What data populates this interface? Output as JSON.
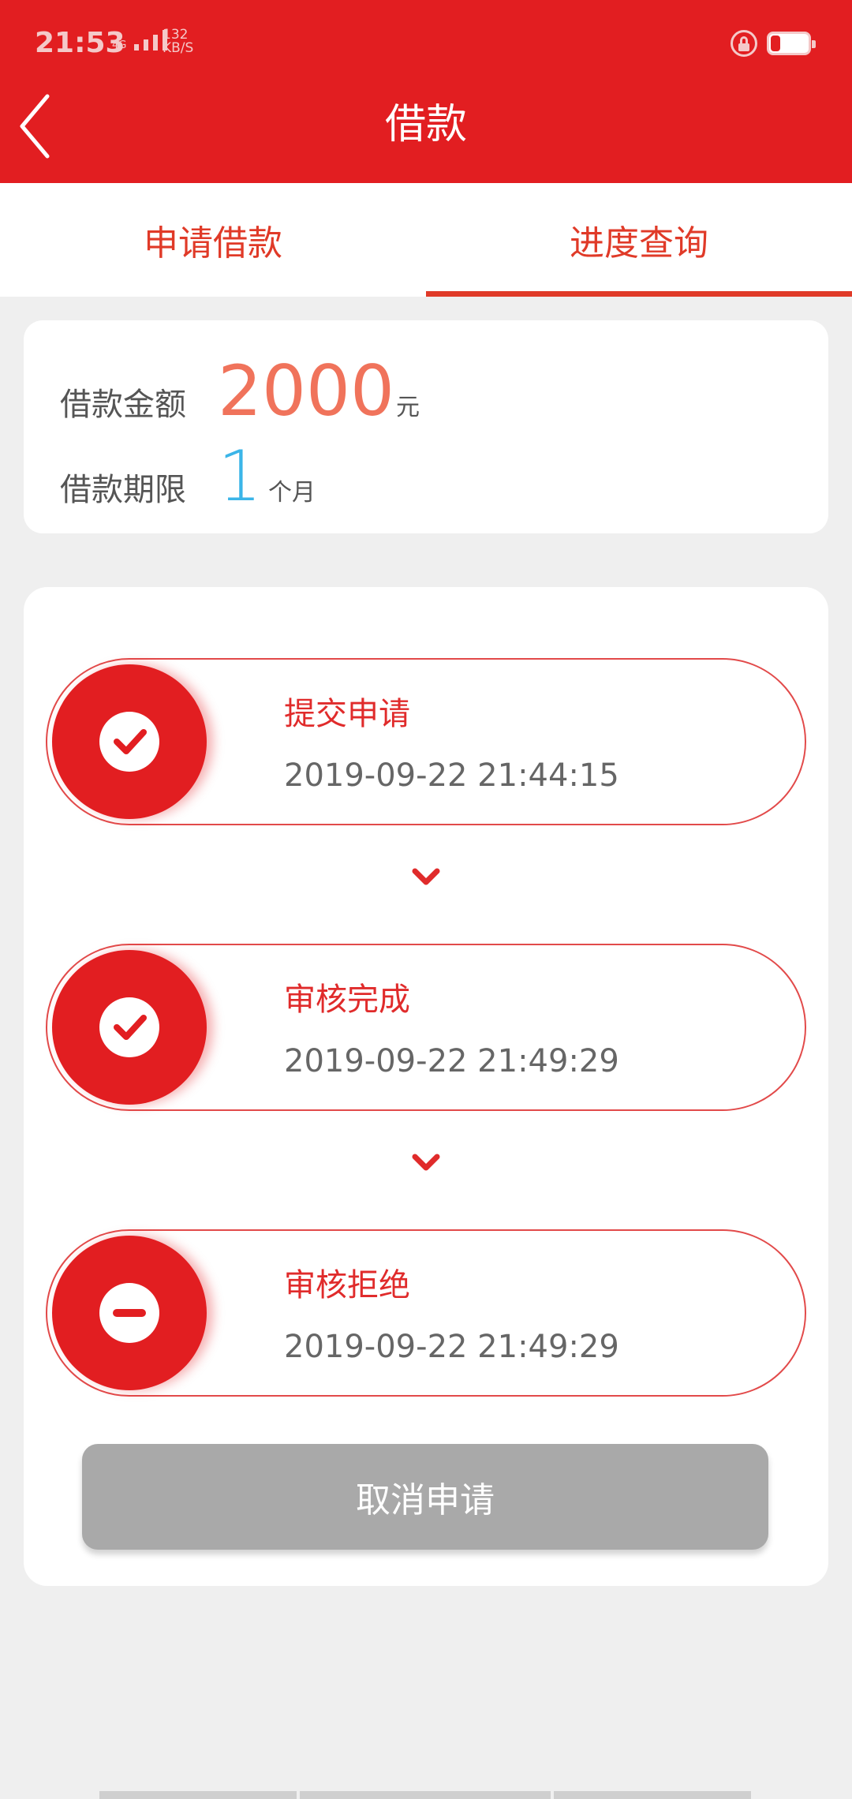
{
  "status_bar": {
    "time": "21:53",
    "network": "4G",
    "speed_value": "132",
    "speed_unit": "KB/S",
    "battery_level": 0.25
  },
  "header": {
    "title": "借款",
    "back_icon": "chevron-left-icon"
  },
  "tabs": [
    {
      "label": "申请借款",
      "active": false
    },
    {
      "label": "进度查询",
      "active": true
    }
  ],
  "loan": {
    "amount_label": "借款金额",
    "amount_value": "2000",
    "amount_unit": "元",
    "term_label": "借款期限",
    "term_value": "1",
    "term_unit": "个月"
  },
  "steps": [
    {
      "title": "提交申请",
      "time": "2019-09-22 21:44:15",
      "icon": "check-icon"
    },
    {
      "title": "审核完成",
      "time": "2019-09-22 21:49:29",
      "icon": "check-icon"
    },
    {
      "title": "审核拒绝",
      "time": "2019-09-22 21:49:29",
      "icon": "minus-icon"
    }
  ],
  "actions": {
    "cancel_label": "取消申请"
  },
  "colors": {
    "brand_red": "#e21e21",
    "amount_orange": "#f0735b",
    "term_blue": "#3bb5e8",
    "disabled_gray": "#a9a9a9"
  }
}
